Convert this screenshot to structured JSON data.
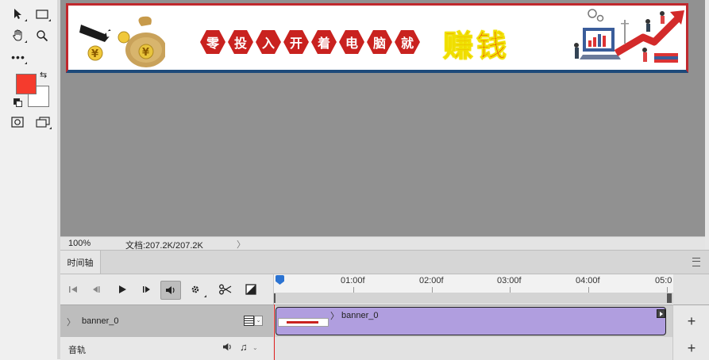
{
  "toolbar": {
    "tools": [
      {
        "name": "move-tool",
        "icon": "move-arrow-icon"
      },
      {
        "name": "select-tool",
        "icon": "rectangle-select-icon"
      },
      {
        "name": "hand-tool",
        "icon": "hand-icon"
      },
      {
        "name": "zoom-tool",
        "icon": "magnifier-icon"
      },
      {
        "name": "more-tools",
        "icon": "ellipsis-icon"
      }
    ],
    "foreground_color": "#f53b2d",
    "background_color": "#ffffff"
  },
  "canvas": {
    "background": "#919191",
    "banner": {
      "hex_chars": [
        "零",
        "投",
        "入",
        "开",
        "着",
        "电",
        "脑",
        "就"
      ],
      "highlight": "赚钱",
      "left_art": "money-bag-hand-icon",
      "right_art": "growth-chart-people-icon"
    }
  },
  "status": {
    "zoom": "100%",
    "doc": "文档:207.2K/207.2K",
    "chevron": "〉"
  },
  "timeline": {
    "tab_label": "时间轴",
    "ruler_labels": [
      "01:00f",
      "02:00f",
      "03:00f",
      "04:00f",
      "05:0"
    ],
    "tracks": [
      {
        "name": "banner_0",
        "clip_label": "banner_0"
      }
    ],
    "audio_track": "音轨"
  }
}
